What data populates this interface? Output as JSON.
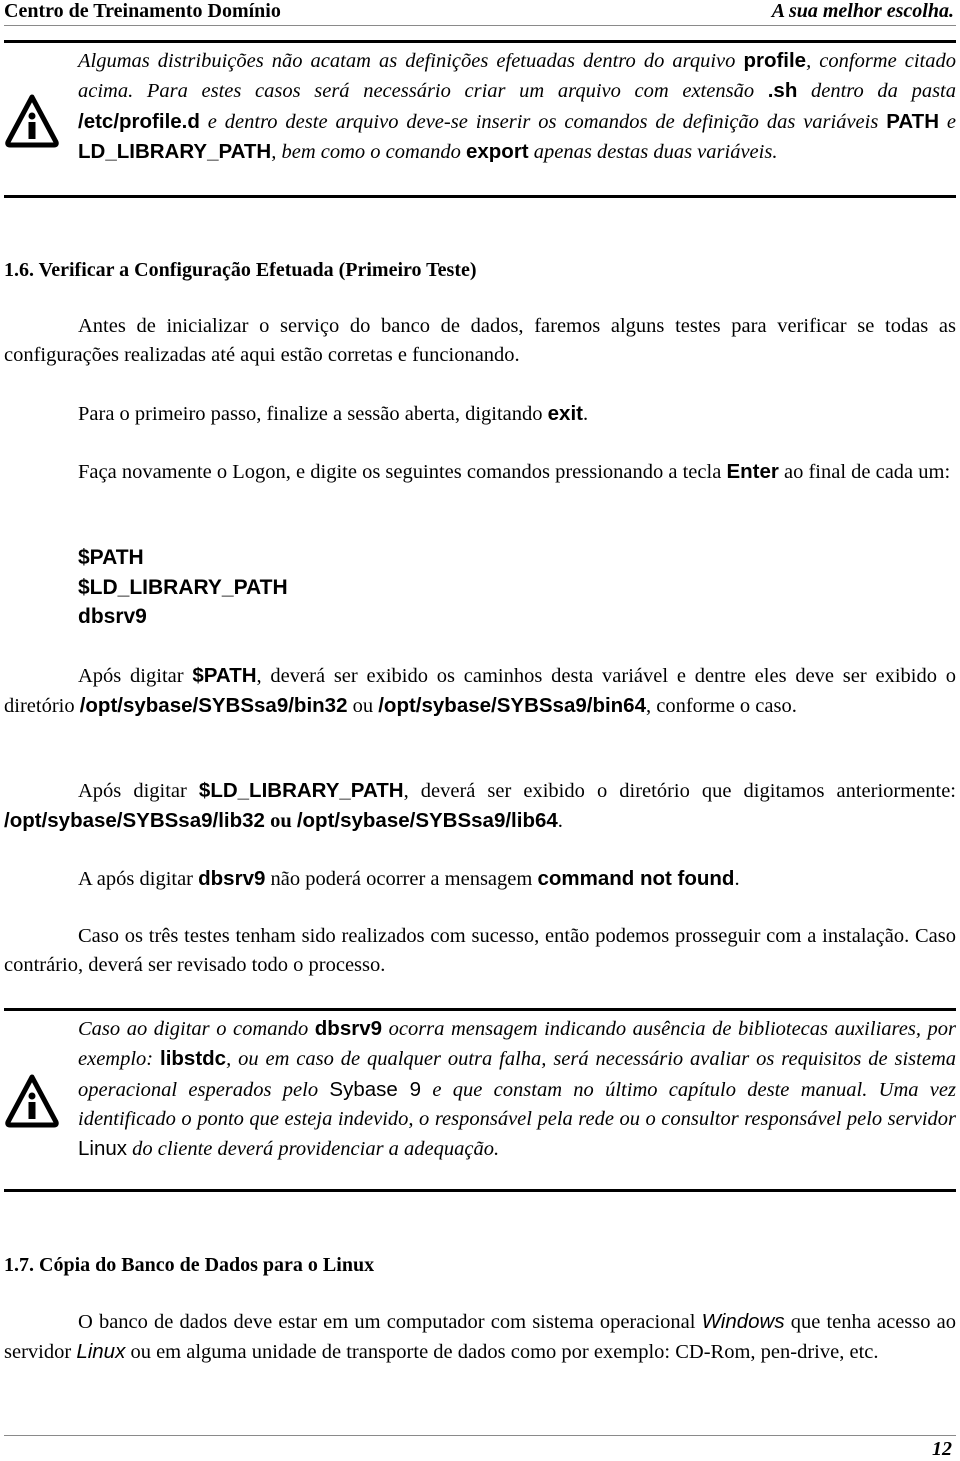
{
  "header": {
    "left_title": "Centro de Treinamento Domínio",
    "right_slogan": "A sua melhor escolha."
  },
  "note1": {
    "icon": "info-warning-icon",
    "parts": [
      {
        "t": "Algumas distribuições não acatam as definições efetuadas dentro do arquivo ",
        "s": "i"
      },
      {
        "t": "profile",
        "s": "b"
      },
      {
        "t": ", conforme citado acima. Para estes casos será necessário criar um arquivo com extensão ",
        "s": "i"
      },
      {
        "t": ".sh",
        "s": "b"
      },
      {
        "t": " dentro da pasta ",
        "s": "i"
      },
      {
        "t": "/etc/profile.d",
        "s": "b"
      },
      {
        "t": " e dentro deste arquivo deve-se inserir os comandos de definição das variáveis ",
        "s": "i"
      },
      {
        "t": "PATH",
        "s": "b"
      },
      {
        "t": " e ",
        "s": "i"
      },
      {
        "t": "LD_LIBRARY_PATH",
        "s": "b"
      },
      {
        "t": ", bem como o comando ",
        "s": "i"
      },
      {
        "t": "export",
        "s": "b"
      },
      {
        "t": " apenas destas duas variáveis.",
        "s": "i"
      }
    ]
  },
  "section16": {
    "title": "1.6. Verificar a Configuração Efetuada (Primeiro Teste)",
    "p1": [
      {
        "t": "Antes de inicializar o serviço do banco de dados, faremos alguns testes para verificar se todas as configurações realizadas até aqui estão corretas e funcionando.",
        "s": "r"
      }
    ],
    "p2": [
      {
        "t": "Para o primeiro passo, finalize a sessão aberta, digitando ",
        "s": "r"
      },
      {
        "t": "exit",
        "s": "b"
      },
      {
        "t": ".",
        "s": "r"
      }
    ],
    "p3": [
      {
        "t": "Faça novamente o Logon, e digite os seguintes comandos pressionando a tecla ",
        "s": "r"
      },
      {
        "t": "Enter",
        "s": "b"
      },
      {
        "t": " ao final de cada um:",
        "s": "r"
      }
    ],
    "commands": [
      "$PATH",
      "$LD_LIBRARY_PATH",
      "dbsrv9"
    ],
    "p4": [
      {
        "t": "Após digitar ",
        "s": "r"
      },
      {
        "t": "$PATH",
        "s": "b"
      },
      {
        "t": ", deverá ser exibido os caminhos desta variável e dentre eles deve ser exibido o diretório ",
        "s": "r"
      },
      {
        "t": "/opt/sybase/SYBSsa9/bin32",
        "s": "b"
      },
      {
        "t": " ou ",
        "s": "r"
      },
      {
        "t": "/opt/sybase/SYBSsa9/bin64",
        "s": "b"
      },
      {
        "t": ", conforme o caso.",
        "s": "r"
      }
    ],
    "p5": [
      {
        "t": "Após digitar ",
        "s": "r"
      },
      {
        "t": "$LD_LIBRARY_PATH",
        "s": "b"
      },
      {
        "t": ", deverá ser exibido o diretório que digitamos anteriormente: ",
        "s": "r"
      },
      {
        "t": "/opt/sybase/SYBSsa9/lib32",
        "s": "b"
      },
      {
        "t": " ou ",
        "s": "rb"
      },
      {
        "t": "/opt/sybase/SYBSsa9/lib64",
        "s": "b"
      },
      {
        "t": ".",
        "s": "r"
      }
    ],
    "p6": [
      {
        "t": "A após digitar ",
        "s": "r"
      },
      {
        "t": "dbsrv9",
        "s": "b"
      },
      {
        "t": " não poderá ocorrer a mensagem ",
        "s": "r"
      },
      {
        "t": "command not found",
        "s": "b"
      },
      {
        "t": ".",
        "s": "r"
      }
    ],
    "p7": [
      {
        "t": "Caso os três testes tenham sido realizados com sucesso, então podemos prosseguir com a instalação. Caso contrário, deverá ser revisado todo o processo.",
        "s": "r"
      }
    ]
  },
  "note2": {
    "icon": "info-warning-icon",
    "parts": [
      {
        "t": "Caso ao digitar o comando ",
        "s": "i"
      },
      {
        "t": "dbsrv9",
        "s": "b"
      },
      {
        "t": " ocorra mensagem indicando ausência de bibliotecas auxiliares, por exemplo: ",
        "s": "i"
      },
      {
        "t": "libstdc",
        "s": "b"
      },
      {
        "t": ", ou em caso de qualquer outra falha, será necessário avaliar os requisitos de sistema operacional esperados pelo ",
        "s": "i"
      },
      {
        "t": "Sybase 9",
        "s": "n"
      },
      {
        "t": " e que constam no último capítulo deste manual. Uma vez identificado o ponto que esteja indevido, o responsável pela rede ou o consultor responsável pelo servidor ",
        "s": "i"
      },
      {
        "t": "Linux",
        "s": "n"
      },
      {
        "t": " do cliente deverá providenciar a adequação.",
        "s": "i"
      }
    ]
  },
  "section17": {
    "title": "1.7. Cópia do Banco de Dados para o Linux",
    "p1": [
      {
        "t": "O banco de dados deve estar em um computador com sistema operacional ",
        "s": "r"
      },
      {
        "t": "Windows",
        "s": "si"
      },
      {
        "t": " que tenha acesso ao servidor ",
        "s": "r"
      },
      {
        "t": "Linux",
        "s": "si"
      },
      {
        "t": " ou em alguma unidade de transporte de dados como por exemplo: CD-Rom, pen-drive, etc.",
        "s": "r"
      }
    ]
  },
  "footer": {
    "page_number": "12"
  }
}
